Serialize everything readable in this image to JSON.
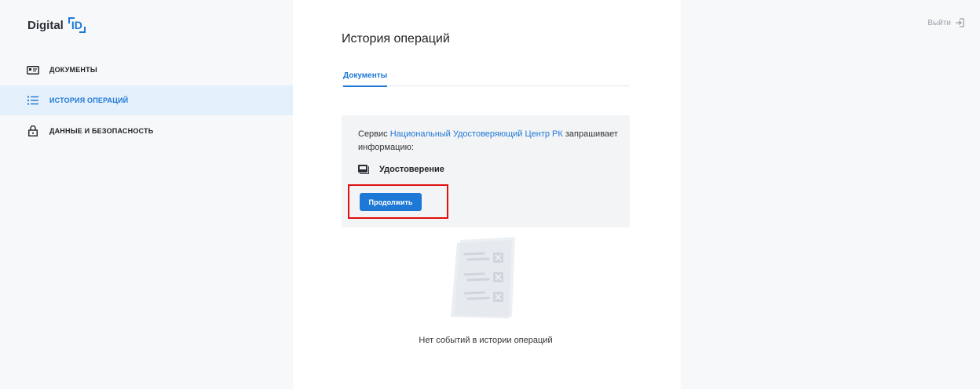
{
  "logo": {
    "text": "Digital",
    "mark": "ID"
  },
  "sidebar": {
    "items": [
      {
        "label": "ДОКУМЕНТЫ",
        "icon": "id-card-icon"
      },
      {
        "label": "ИСТОРИЯ ОПЕРАЦИЙ",
        "icon": "list-icon",
        "active": true
      },
      {
        "label": "ДАННЫЕ И БЕЗОПАСНОСТЬ",
        "icon": "lock-icon"
      }
    ]
  },
  "main": {
    "title": "История операций",
    "tabs": [
      {
        "label": "Документы",
        "active": true
      }
    ],
    "request": {
      "prefix": "Сервис ",
      "service": "Национальный Удостоверяющий Центр РК",
      "suffix": " запрашивает информацию:",
      "document": "Удостоверение",
      "button": "Продолжить"
    },
    "empty_text": "Нет событий в истории операций"
  },
  "header": {
    "logout": "Выйти"
  },
  "colors": {
    "accent": "#1e78d6",
    "highlight": "#e01010",
    "sidebar_active": "#e4f0fb"
  }
}
